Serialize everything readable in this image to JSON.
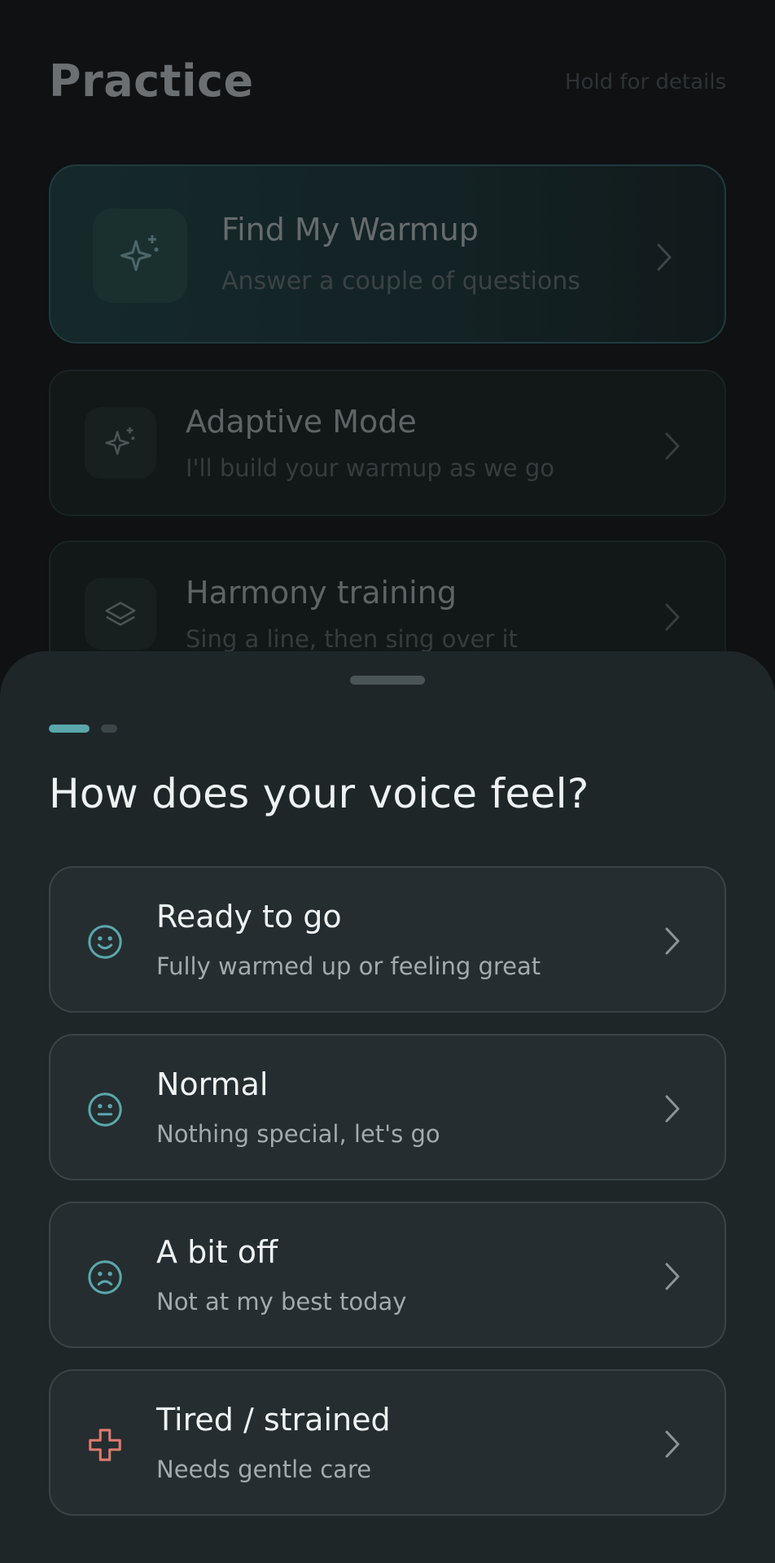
{
  "background": {
    "title": "Practice",
    "hint": "Hold for details",
    "cards": [
      {
        "title": "Find My Warmup",
        "subtitle": "Answer a couple of questions",
        "icon": "sparkles-icon"
      },
      {
        "title": "Adaptive Mode",
        "subtitle": "I'll build your warmup as we go",
        "icon": "sparkles-icon"
      },
      {
        "title": "Harmony training",
        "subtitle": "Sing a line, then sing over it",
        "icon": "layers-icon"
      }
    ]
  },
  "sheet": {
    "step_current": 1,
    "step_total": 2,
    "title": "How does your voice feel?",
    "options": [
      {
        "title": "Ready to go",
        "subtitle": "Fully warmed up or feeling great",
        "icon": "smile-icon",
        "color": "#5aa7ac"
      },
      {
        "title": "Normal",
        "subtitle": "Nothing special, let's go",
        "icon": "neutral-face-icon",
        "color": "#5aa7ac"
      },
      {
        "title": "A bit off",
        "subtitle": "Not at my best today",
        "icon": "frown-icon",
        "color": "#5aa7ac"
      },
      {
        "title": "Tired / strained",
        "subtitle": "Needs gentle care",
        "icon": "medical-cross-icon",
        "color": "#e07a6e"
      }
    ]
  },
  "colors": {
    "accent": "#5aa7ac",
    "warning": "#e07a6e",
    "sheet_bg": "#1e2628"
  }
}
